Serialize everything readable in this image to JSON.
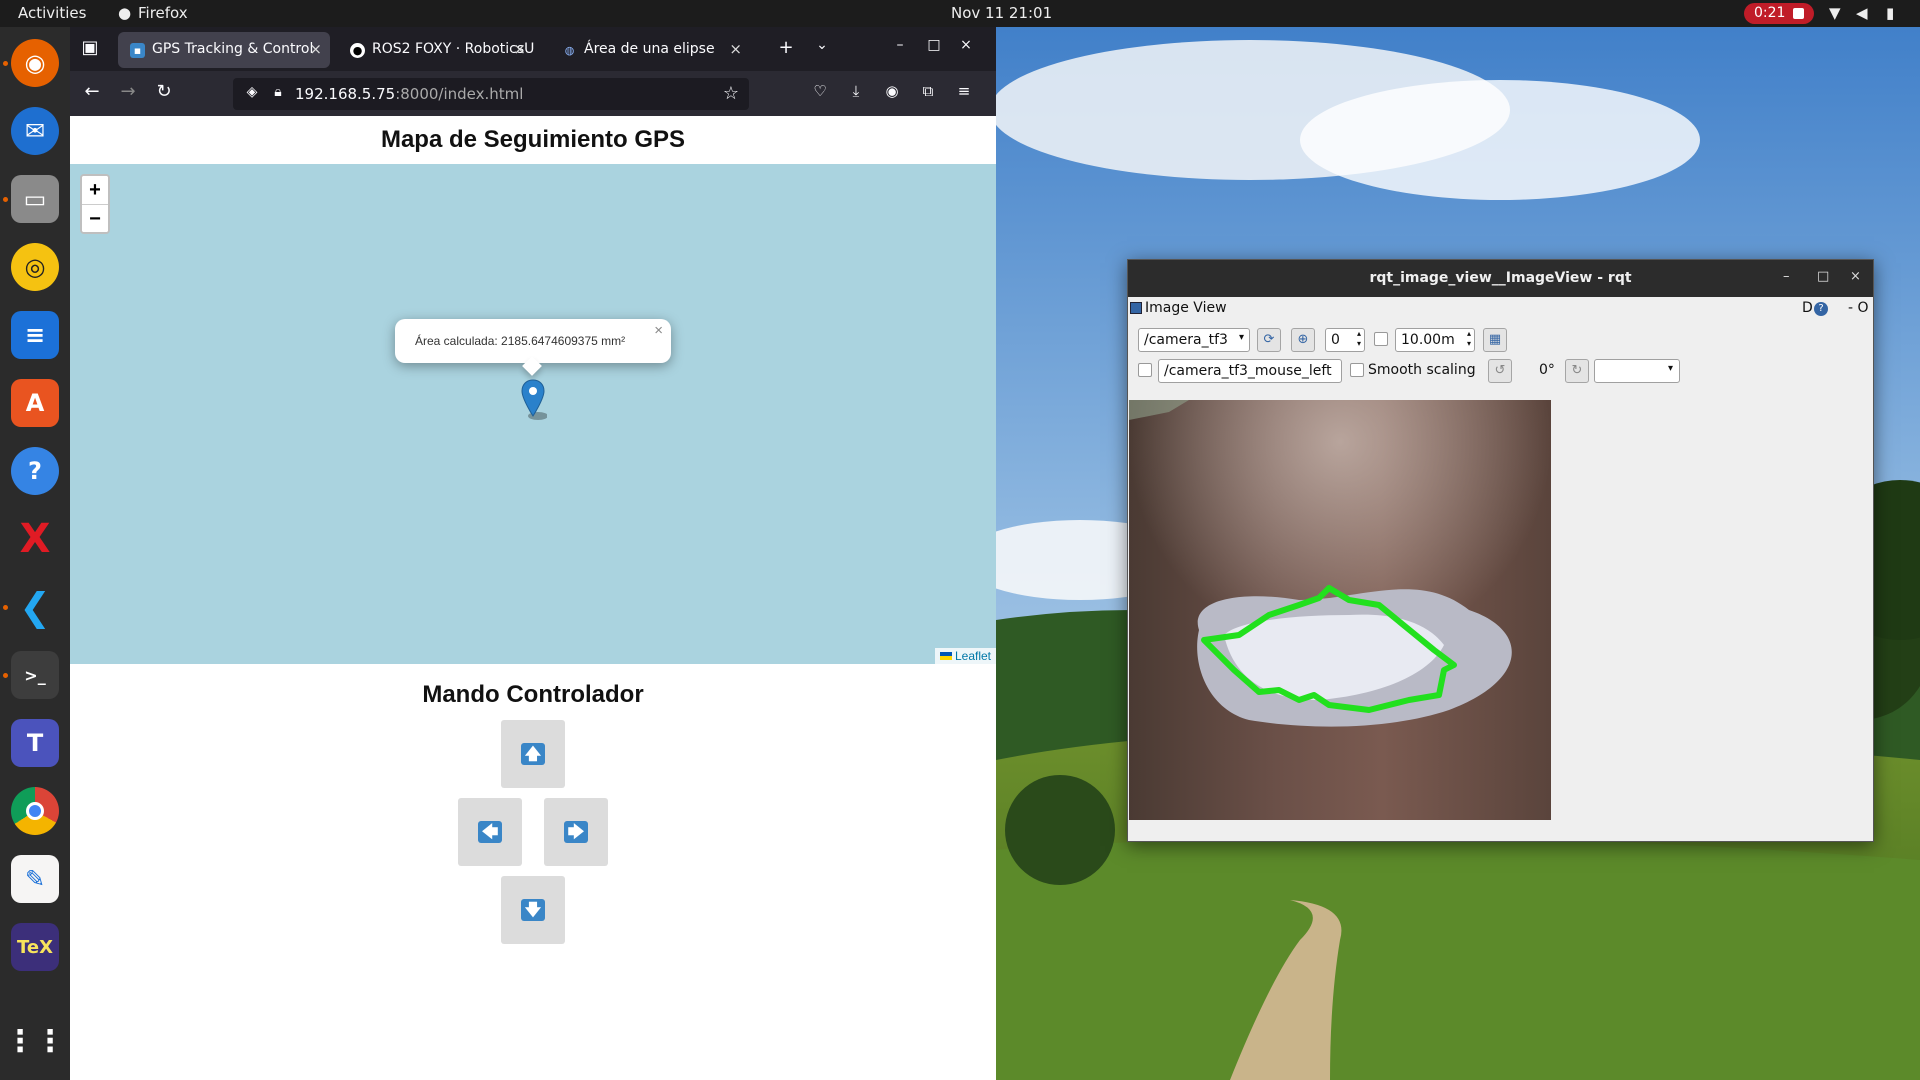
{
  "topbar": {
    "activities": "Activities",
    "app_name": "Firefox",
    "clock": "Nov 11  21:01",
    "recording_time": "0:21"
  },
  "dock": {
    "items": [
      "firefox-icon",
      "thunderbird-icon",
      "files-icon",
      "rhythmbox-icon",
      "writer-icon",
      "app-center-icon",
      "help-icon",
      "xtext-icon",
      "vscode-icon",
      "terminal-icon",
      "teams-icon",
      "chrome-icon",
      "text-editor-icon",
      "texmaker-icon",
      "app-grid-icon"
    ]
  },
  "browser": {
    "tabs": [
      {
        "label": "GPS Tracking & Control"
      },
      {
        "label": "ROS2 FOXY · RoboticsU"
      },
      {
        "label": "Área de una elipse"
      }
    ],
    "url_host": "192.168.5.75",
    "url_rest": ":8000/index.html"
  },
  "page": {
    "title": "Mapa de Seguimiento GPS",
    "map": {
      "zoom_in": "+",
      "zoom_out": "−",
      "popup_text": "Área calculada: 2185.6474609375 mm²",
      "popup_close": "×",
      "attribution": "Leaflet"
    },
    "controller": {
      "title": "Mando Controlador",
      "up": "🡅",
      "left": "🡄",
      "right": "🡆",
      "down": "🡇"
    }
  },
  "rqt": {
    "window_title": "rqt_image_view__ImageView - rqt",
    "plugin_title": "Image View",
    "header_right": "D",
    "header_dash": "- O",
    "topic": "/camera_tf3",
    "spin_value": "0",
    "range_value": "10.00m",
    "mouse_topic": "/camera_tf3_mouse_left",
    "smooth_scaling": "Smooth scaling",
    "rotation": "0°"
  }
}
